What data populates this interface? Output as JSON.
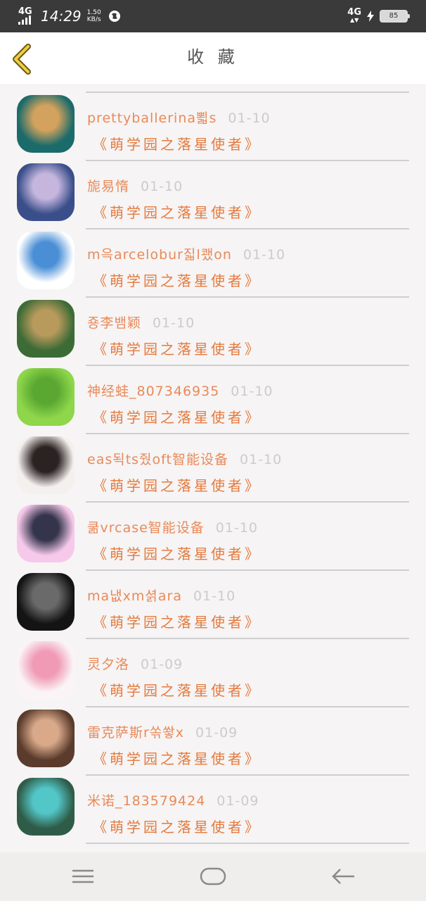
{
  "status_bar": {
    "network_left": "4G",
    "time": "14:29",
    "speed_value": "1.50",
    "speed_unit": "KB/s",
    "network_right": "4G",
    "battery": "85"
  },
  "header": {
    "back_icon": "chevron-left-icon",
    "title": "收 藏"
  },
  "favorites": [
    {
      "name": "prettyballerina뾟s",
      "date": "01-10",
      "book": "《萌学园之落星使者》",
      "avatar_colors": [
        "#1b6b6a",
        "#d2a25e"
      ]
    },
    {
      "name": "旎易惰",
      "date": "01-10",
      "book": "《萌学园之落星使者》",
      "avatar_colors": [
        "#3a4f8a",
        "#c6b6de"
      ]
    },
    {
      "name": "m윽arcelobur짋l쾠on",
      "date": "01-10",
      "book": "《萌学园之落星使者》",
      "avatar_colors": [
        "#ffffff",
        "#4a8fd6"
      ]
    },
    {
      "name": "죵李뱀颖",
      "date": "01-10",
      "book": "《萌学园之落星使者》",
      "avatar_colors": [
        "#3d6b36",
        "#b89a5c"
      ]
    },
    {
      "name": "神经蛙_807346935",
      "date": "01-10",
      "book": "《萌学园之落星使者》",
      "avatar_colors": [
        "#8ed64a",
        "#5aa832"
      ]
    },
    {
      "name": "eas됙ts줬oft智能设备",
      "date": "01-10",
      "book": "《萌学园之落星使者》",
      "avatar_colors": [
        "#f4f0ee",
        "#2b2222"
      ]
    },
    {
      "name": "쿪vrcase智能设备",
      "date": "01-10",
      "book": "《萌学园之落星使者》",
      "avatar_colors": [
        "#f6c9ea",
        "#34344c"
      ]
    },
    {
      "name": "ma냆xm셝ara",
      "date": "01-10",
      "book": "《萌学园之落星使者》",
      "avatar_colors": [
        "#141414",
        "#6a6a6a"
      ]
    },
    {
      "name": "灵夕洛",
      "date": "01-09",
      "book": "《萌学园之落星使者》",
      "avatar_colors": [
        "#fbf4f6",
        "#f09ab6"
      ]
    },
    {
      "name": "雷克萨斯r쏚쐏x",
      "date": "01-09",
      "book": "《萌学园之落星使者》",
      "avatar_colors": [
        "#5a3b2c",
        "#d9a98a"
      ]
    },
    {
      "name": "米诺_183579424",
      "date": "01-09",
      "book": "《萌学园之落星使者》",
      "avatar_colors": [
        "#2f5c48",
        "#53c6c8"
      ]
    }
  ],
  "nav_bar": {
    "menu_icon": "menu-icon",
    "home_icon": "home-icon",
    "back_icon": "back-arrow-icon"
  },
  "colors": {
    "name": "#e88a5a",
    "book": "#e47a3e",
    "date": "#cccccc",
    "status_bar": "#3a3a3a"
  }
}
